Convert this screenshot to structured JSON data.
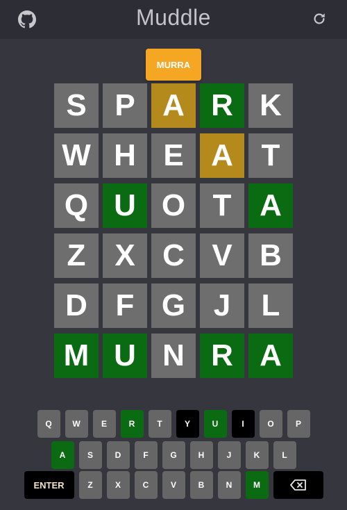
{
  "header": {
    "title": "Muddle"
  },
  "toast": {
    "text": "MURRA"
  },
  "board": {
    "rows": [
      [
        {
          "l": "S",
          "s": "absent"
        },
        {
          "l": "P",
          "s": "absent"
        },
        {
          "l": "A",
          "s": "present"
        },
        {
          "l": "R",
          "s": "correct"
        },
        {
          "l": "K",
          "s": "absent"
        }
      ],
      [
        {
          "l": "W",
          "s": "absent"
        },
        {
          "l": "H",
          "s": "absent"
        },
        {
          "l": "E",
          "s": "absent"
        },
        {
          "l": "A",
          "s": "present"
        },
        {
          "l": "T",
          "s": "absent"
        }
      ],
      [
        {
          "l": "Q",
          "s": "absent"
        },
        {
          "l": "U",
          "s": "correct"
        },
        {
          "l": "O",
          "s": "absent"
        },
        {
          "l": "T",
          "s": "absent"
        },
        {
          "l": "A",
          "s": "correct"
        }
      ],
      [
        {
          "l": "Z",
          "s": "absent"
        },
        {
          "l": "X",
          "s": "absent"
        },
        {
          "l": "C",
          "s": "absent"
        },
        {
          "l": "V",
          "s": "absent"
        },
        {
          "l": "B",
          "s": "absent"
        }
      ],
      [
        {
          "l": "D",
          "s": "absent"
        },
        {
          "l": "F",
          "s": "absent"
        },
        {
          "l": "G",
          "s": "absent"
        },
        {
          "l": "J",
          "s": "absent"
        },
        {
          "l": "L",
          "s": "absent"
        }
      ],
      [
        {
          "l": "M",
          "s": "correct"
        },
        {
          "l": "U",
          "s": "correct"
        },
        {
          "l": "N",
          "s": "absent"
        },
        {
          "l": "R",
          "s": "correct"
        },
        {
          "l": "A",
          "s": "correct"
        }
      ]
    ]
  },
  "keyboard": {
    "rows": [
      [
        {
          "k": "Q",
          "s": "unused"
        },
        {
          "k": "W",
          "s": "unused"
        },
        {
          "k": "E",
          "s": "unused"
        },
        {
          "k": "R",
          "s": "correct"
        },
        {
          "k": "T",
          "s": "unused"
        },
        {
          "k": "Y",
          "s": "black"
        },
        {
          "k": "U",
          "s": "correct"
        },
        {
          "k": "I",
          "s": "black"
        },
        {
          "k": "O",
          "s": "unused"
        },
        {
          "k": "P",
          "s": "unused"
        }
      ],
      [
        {
          "k": "A",
          "s": "correct"
        },
        {
          "k": "S",
          "s": "unused"
        },
        {
          "k": "D",
          "s": "unused"
        },
        {
          "k": "F",
          "s": "unused"
        },
        {
          "k": "G",
          "s": "unused"
        },
        {
          "k": "H",
          "s": "unused"
        },
        {
          "k": "J",
          "s": "unused"
        },
        {
          "k": "K",
          "s": "unused"
        },
        {
          "k": "L",
          "s": "unused"
        }
      ],
      [
        {
          "k": "ENTER",
          "s": "black",
          "wide": true
        },
        {
          "k": "Z",
          "s": "unused"
        },
        {
          "k": "X",
          "s": "unused"
        },
        {
          "k": "C",
          "s": "unused"
        },
        {
          "k": "V",
          "s": "unused"
        },
        {
          "k": "B",
          "s": "unused"
        },
        {
          "k": "N",
          "s": "unused"
        },
        {
          "k": "M",
          "s": "correct"
        },
        {
          "k": "",
          "s": "black",
          "wide": true,
          "icon": "backspace-icon"
        }
      ]
    ]
  },
  "colors": {
    "correct": "#0a6b12",
    "present": "#b58a1c",
    "absent": "#6e6e6e",
    "toast": "#f5a623"
  }
}
